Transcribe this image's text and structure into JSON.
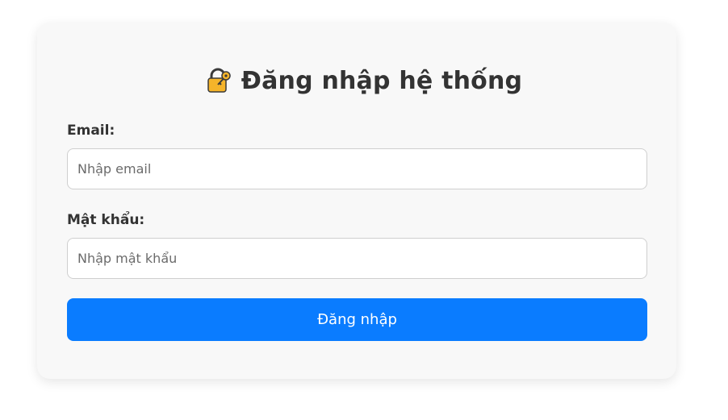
{
  "login": {
    "title": "Đăng nhập hệ thống",
    "title_icon": "locked-with-key-icon",
    "email_label": "Email:",
    "email_placeholder": "Nhập email",
    "password_label": "Mật khẩu:",
    "password_placeholder": "Nhập mật khẩu",
    "submit_label": "Đăng nhập"
  },
  "colors": {
    "accent": "#0a7cff",
    "card_background": "#f8f8f8",
    "text": "#333333"
  }
}
